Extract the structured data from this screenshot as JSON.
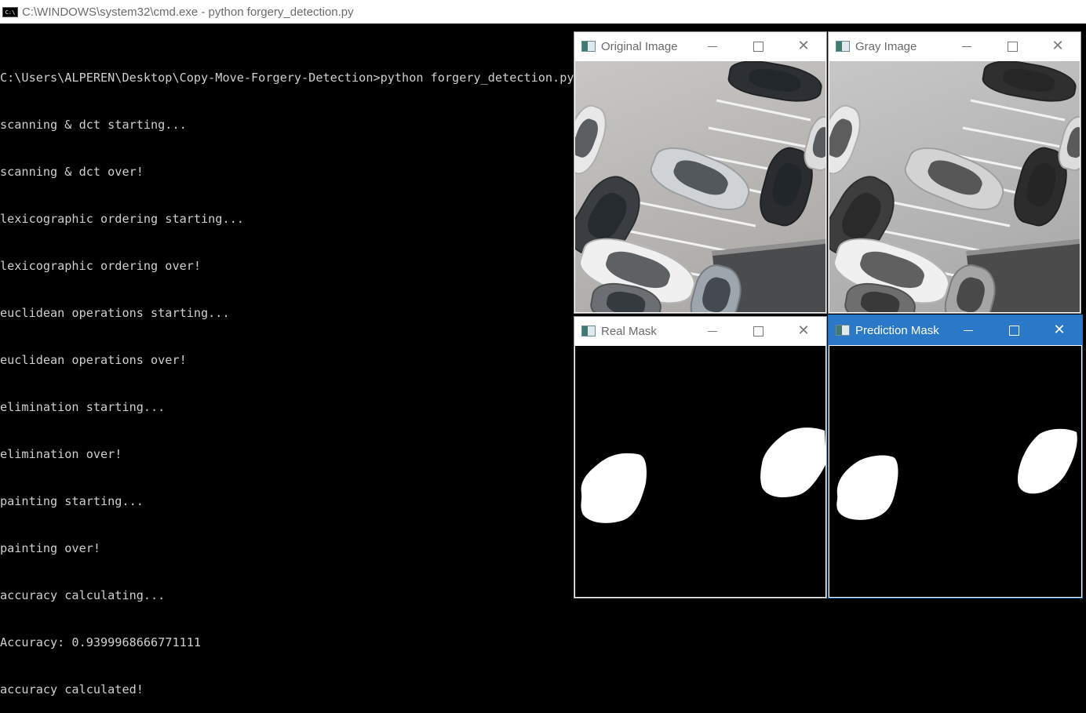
{
  "cmd": {
    "title": "C:\\WINDOWS\\system32\\cmd.exe - python  forgery_detection.py",
    "icon_name": "cmd-icon",
    "icon_text": "C:\\",
    "lines": [
      "C:\\Users\\ALPEREN\\Desktop\\Copy-Move-Forgery-Detection>python forgery_detection.py",
      "scanning & dct starting...",
      "scanning & dct over!",
      "lexicographic ordering starting...",
      "lexicographic ordering over!",
      "euclidean operations starting...",
      "euclidean operations over!",
      "elimination starting...",
      "elimination over!",
      "painting starting...",
      "painting over!",
      "accuracy calculating...",
      "Accuracy: 0.9399968666771111",
      "accuracy calculated!"
    ]
  },
  "windows": {
    "original": {
      "title": "Original Image"
    },
    "gray": {
      "title": "Gray Image"
    },
    "real_mask": {
      "title": "Real Mask"
    },
    "prediction_mask": {
      "title": "Prediction Mask"
    }
  },
  "colors": {
    "active_titlebar": "#2b78c9",
    "console_text": "#cfcfcf"
  }
}
